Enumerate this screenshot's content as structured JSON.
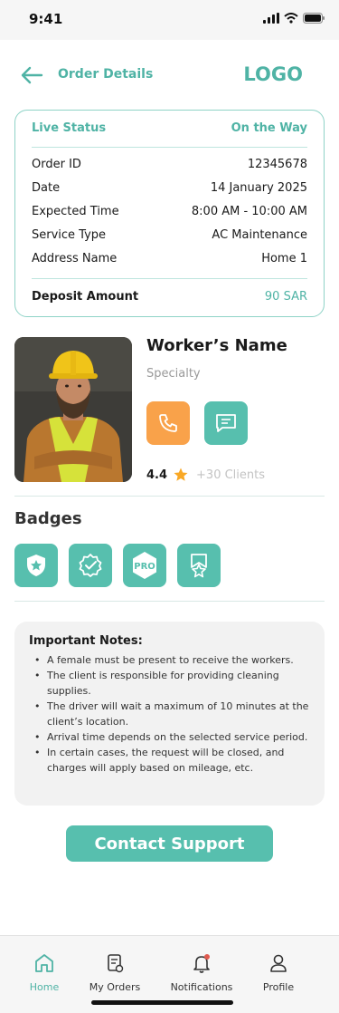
{
  "status_bar": {
    "time": "9:41"
  },
  "header": {
    "title": "Order Details",
    "logo": "LOGO"
  },
  "order": {
    "live_status_label": "Live Status",
    "live_status_value": "On the Way",
    "rows": [
      {
        "label": "Order ID",
        "value": "12345678"
      },
      {
        "label": "Date",
        "value": "14 January 2025"
      },
      {
        "label": "Expected Time",
        "value": "8:00 AM - 10:00 AM"
      },
      {
        "label": "Service Type",
        "value": "AC Maintenance"
      },
      {
        "label": "Address Name",
        "value": "Home 1"
      }
    ],
    "deposit_label": "Deposit Amount",
    "deposit_value": "90 SAR"
  },
  "worker": {
    "name": "Worker’s Name",
    "specialty": "Specialty",
    "rating": "4.4",
    "clients": "+30 Clients"
  },
  "badges": {
    "title": "Badges",
    "items": [
      "shield-star-icon",
      "verified-check-icon",
      "pro-badge-icon",
      "award-ribbon-icon"
    ],
    "pro_text": "PRO"
  },
  "notes": {
    "title": "Important Notes:",
    "items": [
      "A female must be present to receive the workers.",
      "The client is responsible for providing cleaning supplies.",
      "The driver will wait a maximum of 10 minutes at the client’s location.",
      "Arrival time depends on the selected service period.",
      "In certain cases, the request will be closed, and charges will apply based on mileage, etc."
    ]
  },
  "support_button": "Contact Support",
  "nav": {
    "items": [
      {
        "label": "Home",
        "icon": "home-icon"
      },
      {
        "label": "My Orders",
        "icon": "orders-icon"
      },
      {
        "label": "Notifications",
        "icon": "bell-icon"
      },
      {
        "label": "Profile",
        "icon": "user-icon"
      }
    ],
    "active": "Home"
  },
  "colors": {
    "accent": "#4fb3a5",
    "badge": "#57bfae",
    "call": "#f9a24a",
    "star": "#f9a825",
    "notification_dot": "#e05a4f"
  }
}
